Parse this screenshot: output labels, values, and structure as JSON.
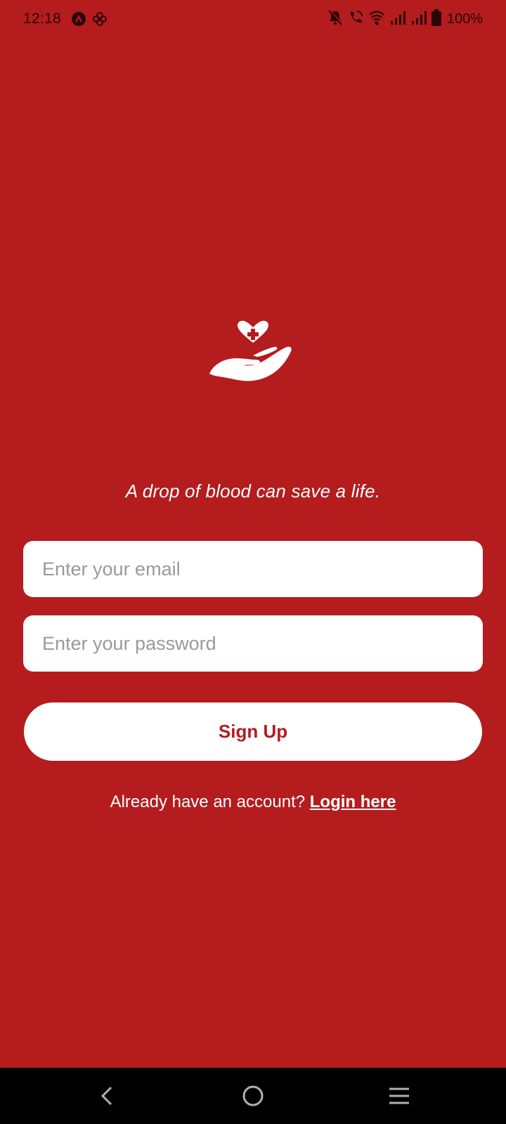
{
  "status_bar": {
    "time": "12:18",
    "battery": "100%",
    "icons": [
      "app-a-icon",
      "pinwheel-icon",
      "bell-off-icon",
      "wifi-call-icon",
      "wifi-icon",
      "signal-1-icon",
      "signal-2-icon",
      "battery-icon"
    ]
  },
  "logo": {
    "icon": "hand-heart-plus-icon"
  },
  "tagline": "A drop of blood can save a life.",
  "form": {
    "email_placeholder": "Enter your email",
    "password_placeholder": "Enter your password",
    "signup_label": "Sign Up"
  },
  "footer": {
    "prompt": "Already have an account?",
    "login_link": "Login here"
  },
  "nav": {
    "buttons": [
      "back-icon",
      "home-icon",
      "recents-menu-icon"
    ]
  },
  "colors": {
    "background": "#B41C1E",
    "surface": "#FFFFFF",
    "accent_text": "#B41C1E"
  }
}
